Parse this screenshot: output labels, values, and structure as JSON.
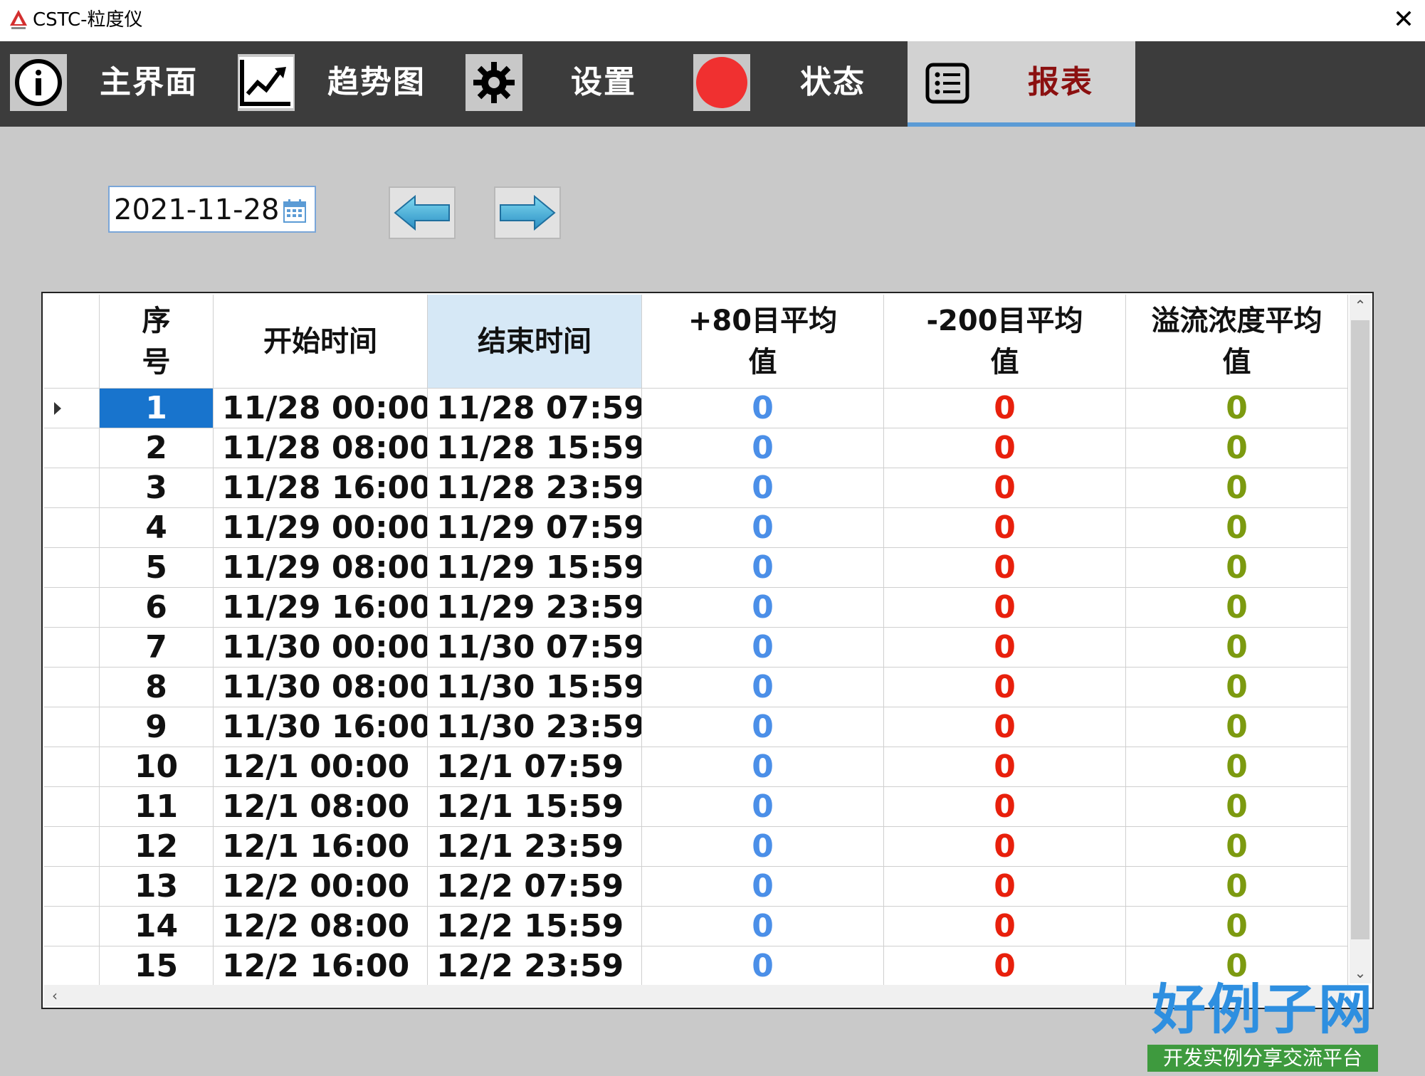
{
  "window": {
    "title": "CSTC-粒度仪",
    "close_glyph": "✕"
  },
  "toolbar": {
    "items": [
      {
        "label": "主界面",
        "icon": "info-icon"
      },
      {
        "label": "趋势图",
        "icon": "trend-chart-icon"
      },
      {
        "label": "设置",
        "icon": "gear-icon"
      },
      {
        "label": "状态",
        "icon": "status-red-dot-icon"
      },
      {
        "label": "报表",
        "icon": "report-list-icon",
        "active": true
      }
    ],
    "active_color": "#8b1010",
    "active_underline": "#5b9bd5"
  },
  "date_picker": {
    "value": "2021-11-28",
    "icon": "calendar-icon"
  },
  "nav": {
    "prev_icon": "arrow-left-icon",
    "next_icon": "arrow-right-icon"
  },
  "grid": {
    "headers": [
      "序\n号",
      "开始时间",
      "结束时间",
      "+80目平均\n值",
      "-200目平均\n值",
      "溢流浓度平均\n值"
    ],
    "sorted_column": 2,
    "value_colors": [
      "#4b8fe8",
      "#e8200c",
      "#7c9a10"
    ],
    "selected_row": 0,
    "rows": [
      {
        "no": "1",
        "start": "11/28 00:00",
        "end": "11/28 07:59",
        "plus80": "0",
        "minus200": "0",
        "overflow": "0"
      },
      {
        "no": "2",
        "start": "11/28 08:00",
        "end": "11/28 15:59",
        "plus80": "0",
        "minus200": "0",
        "overflow": "0"
      },
      {
        "no": "3",
        "start": "11/28 16:00",
        "end": "11/28 23:59",
        "plus80": "0",
        "minus200": "0",
        "overflow": "0"
      },
      {
        "no": "4",
        "start": "11/29 00:00",
        "end": "11/29 07:59",
        "plus80": "0",
        "minus200": "0",
        "overflow": "0"
      },
      {
        "no": "5",
        "start": "11/29 08:00",
        "end": "11/29 15:59",
        "plus80": "0",
        "minus200": "0",
        "overflow": "0"
      },
      {
        "no": "6",
        "start": "11/29 16:00",
        "end": "11/29 23:59",
        "plus80": "0",
        "minus200": "0",
        "overflow": "0"
      },
      {
        "no": "7",
        "start": "11/30 00:00",
        "end": "11/30 07:59",
        "plus80": "0",
        "minus200": "0",
        "overflow": "0"
      },
      {
        "no": "8",
        "start": "11/30 08:00",
        "end": "11/30 15:59",
        "plus80": "0",
        "minus200": "0",
        "overflow": "0"
      },
      {
        "no": "9",
        "start": "11/30 16:00",
        "end": "11/30 23:59",
        "plus80": "0",
        "minus200": "0",
        "overflow": "0"
      },
      {
        "no": "10",
        "start": "12/1 00:00",
        "end": "12/1 07:59",
        "plus80": "0",
        "minus200": "0",
        "overflow": "0"
      },
      {
        "no": "11",
        "start": "12/1 08:00",
        "end": "12/1 15:59",
        "plus80": "0",
        "minus200": "0",
        "overflow": "0"
      },
      {
        "no": "12",
        "start": "12/1 16:00",
        "end": "12/1 23:59",
        "plus80": "0",
        "minus200": "0",
        "overflow": "0"
      },
      {
        "no": "13",
        "start": "12/2 00:00",
        "end": "12/2 07:59",
        "plus80": "0",
        "minus200": "0",
        "overflow": "0"
      },
      {
        "no": "14",
        "start": "12/2 08:00",
        "end": "12/2 15:59",
        "plus80": "0",
        "minus200": "0",
        "overflow": "0"
      },
      {
        "no": "15",
        "start": "12/2 16:00",
        "end": "12/2 23:59",
        "plus80": "0",
        "minus200": "0",
        "overflow": "0"
      }
    ]
  },
  "watermark": {
    "brand": "好例子网",
    "tagline": "开发实例分享交流平台"
  }
}
